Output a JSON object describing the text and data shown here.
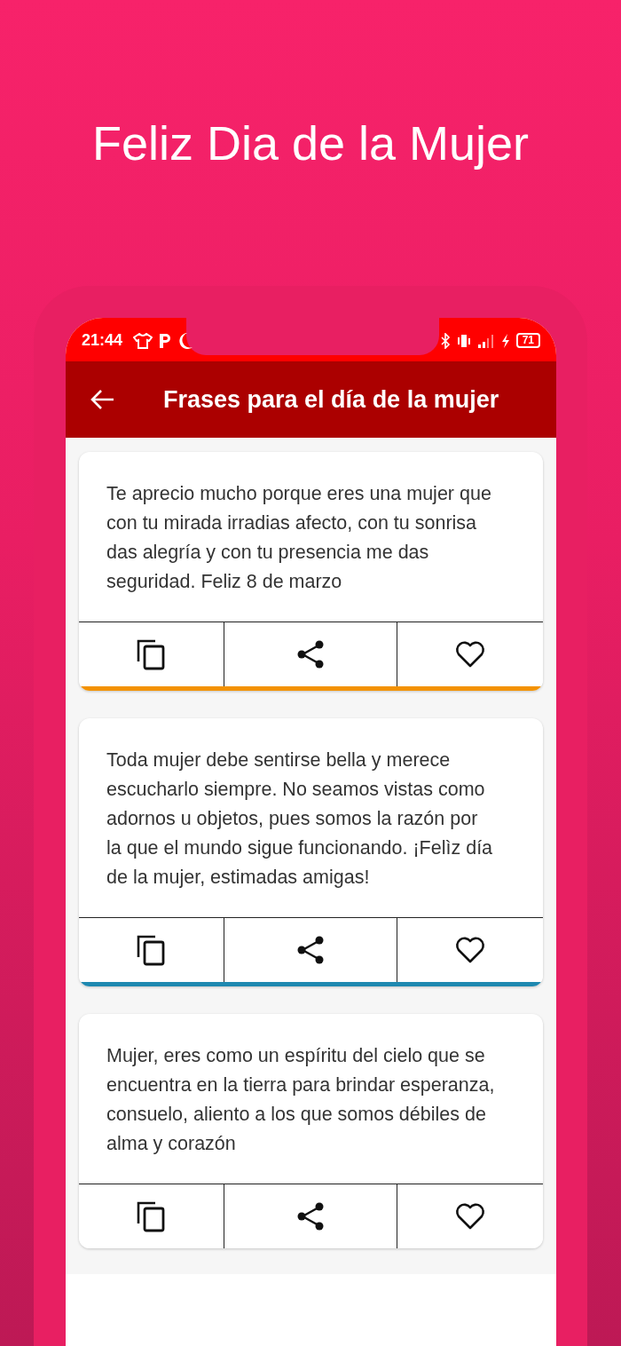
{
  "headline": "Feliz Dia de la Mujer",
  "status_bar": {
    "time": "21:44",
    "battery": "71"
  },
  "app_bar": {
    "title": "Frases para el día de la mujer"
  },
  "cards": [
    {
      "text": "Te aprecio mucho porque eres una mujer que con tu mirada irradias afecto, con tu sonrisa das alegría y con tu presencia me das seguridad. Feliz 8 de marzo",
      "color": "#f39200"
    },
    {
      "text": "Toda mujer debe sentirse bella y merece escucharlo siempre. No seamos vistas como adornos u objetos, pues somos la razón por la que el mundo sigue funcionando. ¡Felìz día de la mujer, estimadas amigas!",
      "color": "#1e88b0"
    },
    {
      "text": "Mujer, eres como un espíritu del cielo que se encuentra en la tierra para brindar esperanza, consuelo, aliento a los que somos débiles de alma y corazón"
    }
  ]
}
